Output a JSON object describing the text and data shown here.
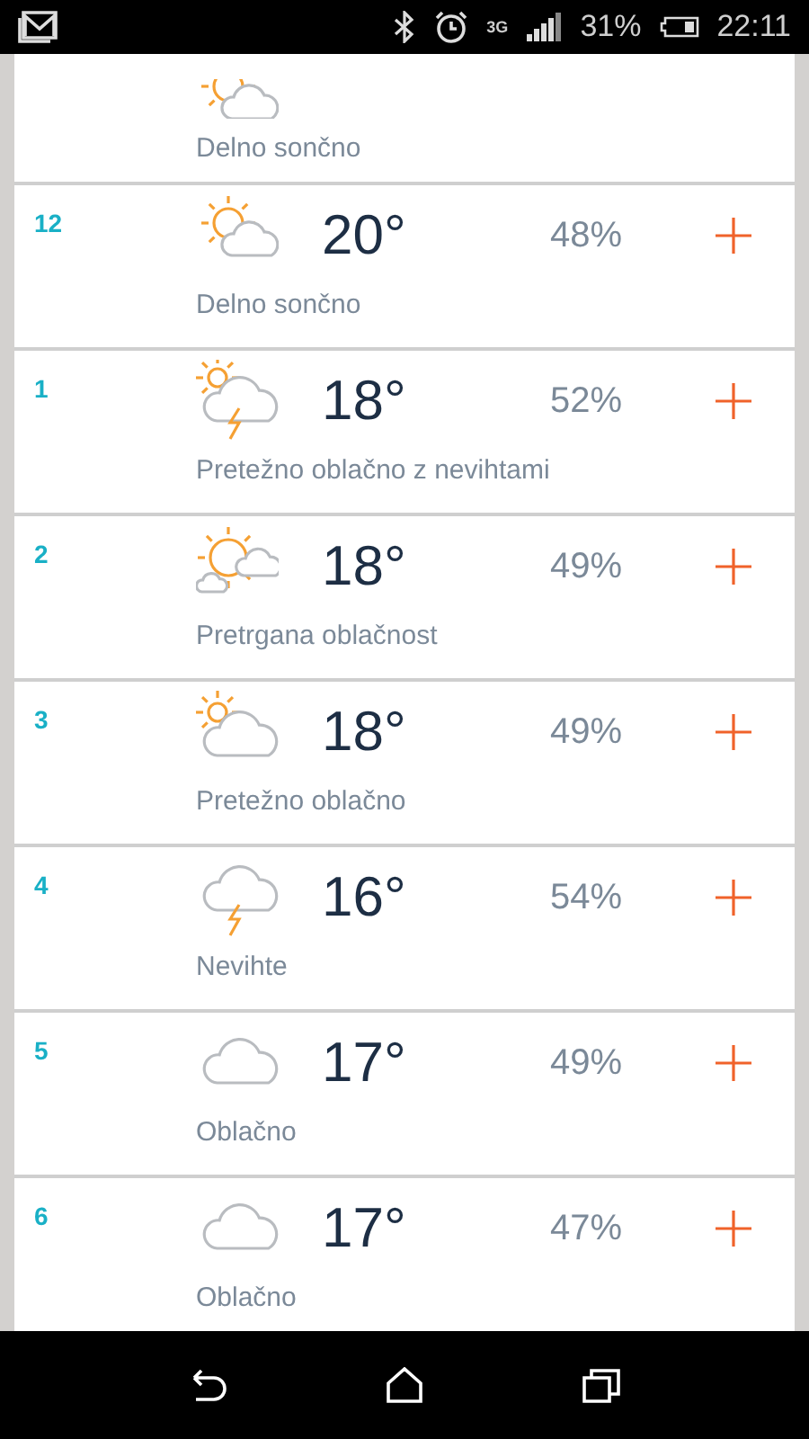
{
  "status_bar": {
    "network": "3G",
    "battery": "31%",
    "time": "22:11"
  },
  "partial_top_row": {
    "description": "Delno sončno",
    "kind": "partly-sunny"
  },
  "rows": [
    {
      "hour": "12",
      "kind": "partly-sunny",
      "temperature": "20°",
      "humidity": "48%",
      "description": "Delno sončno"
    },
    {
      "hour": "1",
      "kind": "storm-sun",
      "temperature": "18°",
      "humidity": "52%",
      "description": "Pretežno oblačno z nevihtami"
    },
    {
      "hour": "2",
      "kind": "broken",
      "temperature": "18°",
      "humidity": "49%",
      "description": "Pretrgana oblačnost"
    },
    {
      "hour": "3",
      "kind": "mostly-cloudy",
      "temperature": "18°",
      "humidity": "49%",
      "description": "Pretežno oblačno"
    },
    {
      "hour": "4",
      "kind": "storm",
      "temperature": "16°",
      "humidity": "54%",
      "description": "Nevihte"
    },
    {
      "hour": "5",
      "kind": "cloudy",
      "temperature": "17°",
      "humidity": "49%",
      "description": "Oblačno"
    },
    {
      "hour": "6",
      "kind": "cloudy",
      "temperature": "17°",
      "humidity": "47%",
      "description": "Oblačno"
    }
  ]
}
